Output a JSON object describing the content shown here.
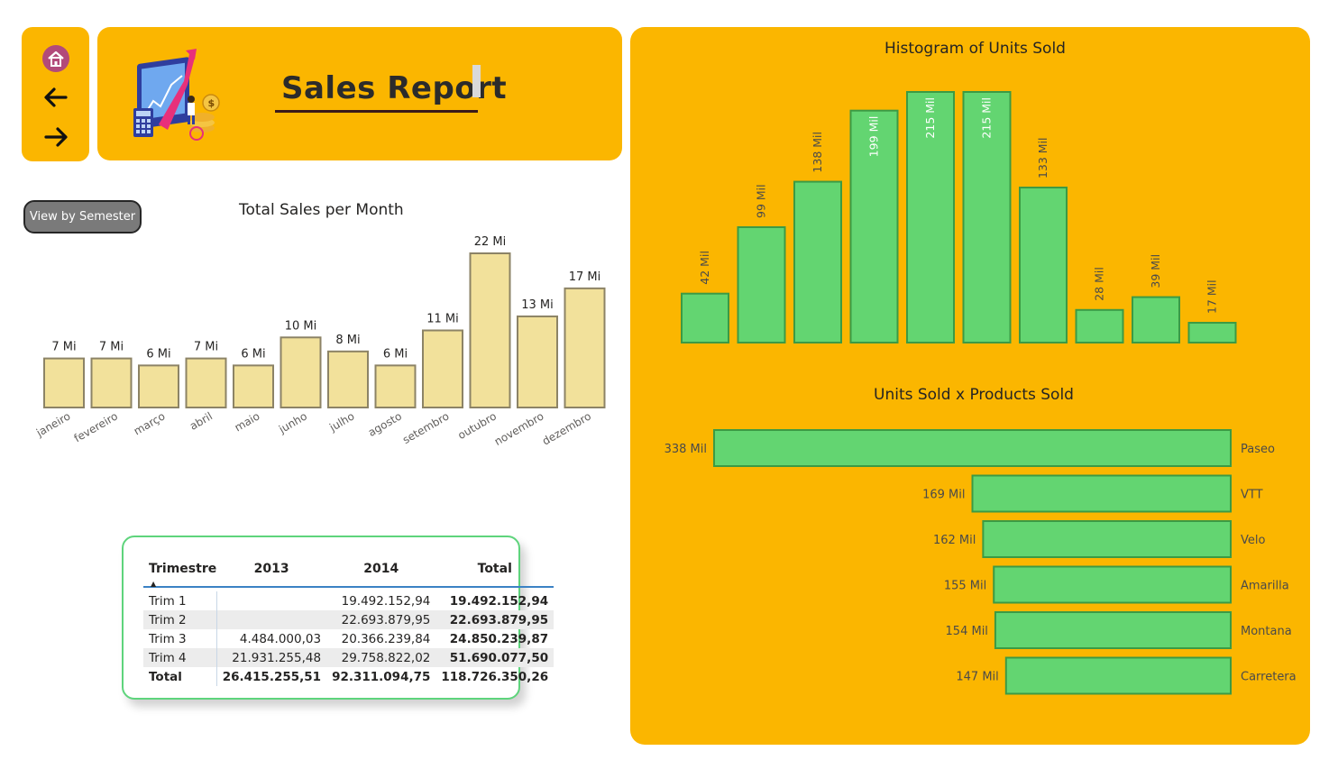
{
  "nav": {
    "home_icon": "home-icon",
    "back_icon": "arrow-left-icon",
    "forward_icon": "arrow-right-icon"
  },
  "header": {
    "title": "Sales Report",
    "illustration_icon": "sales-growth-illustration-icon"
  },
  "controls": {
    "semester_button_label": "View by Semester"
  },
  "colors": {
    "panel": "#FBB600",
    "monthly_bar": "#F2E19B",
    "monthly_bar_border": "#8C8366",
    "green_bar": "#63D571",
    "green_bar_border": "#3C9A44",
    "matrix_border": "#5ed47c"
  },
  "chart_data": [
    {
      "id": "monthly-sales",
      "type": "bar",
      "title": "Total Sales per Month",
      "categories": [
        "janeiro",
        "fevereiro",
        "março",
        "abril",
        "maio",
        "junho",
        "julho",
        "agosto",
        "setembro",
        "outubro",
        "novembro",
        "dezembro"
      ],
      "values": [
        7,
        7,
        6,
        7,
        6,
        10,
        8,
        6,
        11,
        22,
        13,
        17
      ],
      "data_labels": [
        "7 Mi",
        "7 Mi",
        "6 Mi",
        "7 Mi",
        "6 Mi",
        "10 Mi",
        "8 Mi",
        "6 Mi",
        "11 Mi",
        "22 Mi",
        "13 Mi",
        "17 Mi"
      ],
      "unit": "Mi",
      "grid": false
    },
    {
      "id": "units-histogram",
      "type": "bar",
      "title": "Histogram of Units Sold",
      "values": [
        42,
        99,
        138,
        199,
        215,
        215,
        133,
        28,
        39,
        17
      ],
      "data_labels": [
        "42 Mil",
        "99 Mil",
        "138 Mil",
        "199 Mil",
        "215 Mil",
        "215 Mil",
        "133 Mil",
        "28 Mil",
        "39 Mil",
        "17 Mil"
      ],
      "unit": "Mil",
      "grid": false
    },
    {
      "id": "units-by-product",
      "type": "bar",
      "orientation": "horizontal",
      "title": "Units Sold x Products Sold",
      "categories": [
        "Paseo",
        "VTT",
        "Velo",
        "Amarilla",
        "Montana",
        "Carretera"
      ],
      "values": [
        338,
        169,
        162,
        155,
        154,
        147
      ],
      "data_labels": [
        "338 Mil",
        "169 Mil",
        "162 Mil",
        "155 Mil",
        "154 Mil",
        "147 Mil"
      ],
      "unit": "Mil",
      "grid": false
    },
    {
      "id": "quarter-matrix",
      "type": "table",
      "columns": [
        "Trimestre",
        "2013",
        "2014",
        "Total"
      ],
      "rows": [
        [
          "Trim 1",
          "",
          "19.492.152,94",
          "19.492.152,94"
        ],
        [
          "Trim 2",
          "",
          "22.693.879,95",
          "22.693.879,95"
        ],
        [
          "Trim 3",
          "4.484.000,03",
          "20.366.239,84",
          "24.850.239,87"
        ],
        [
          "Trim 4",
          "21.931.255,48",
          "29.758.822,02",
          "51.690.077,50"
        ]
      ],
      "total": [
        "Total",
        "26.415.255,51",
        "92.311.094,75",
        "118.726.350,26"
      ],
      "sort_indicator": "▲"
    }
  ]
}
